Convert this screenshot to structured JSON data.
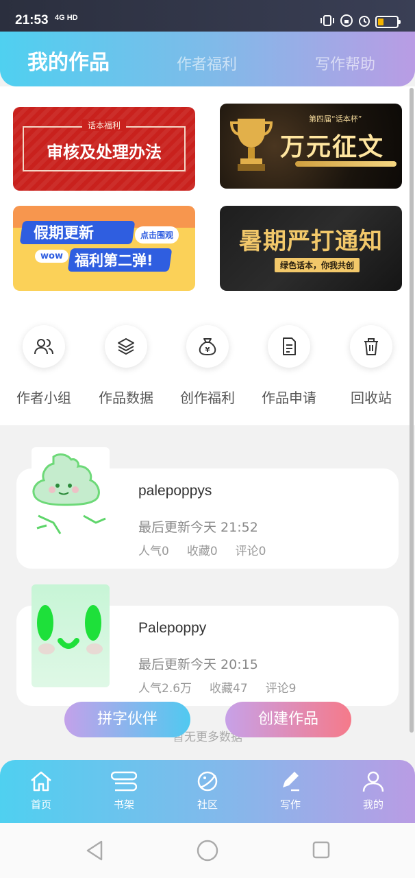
{
  "status_bar": {
    "time": "21:53",
    "network": "4G HD"
  },
  "header": {
    "tabs": [
      {
        "label": "我的作品",
        "active": true
      },
      {
        "label": "作者福利",
        "active": false
      },
      {
        "label": "写作帮助",
        "active": false
      }
    ]
  },
  "banners": [
    {
      "tag": "话本福利",
      "title": "审核及处理办法"
    },
    {
      "small": "第四届“话本杯”",
      "title": "万元征文"
    },
    {
      "title": "假期更新",
      "pill": "点击围观",
      "wow": "wow",
      "subtitle": "福利第二弹!"
    },
    {
      "title": "暑期严打通知",
      "subtitle": "绿色话本，你我共创"
    }
  ],
  "shortcuts": [
    {
      "label": "作者小组",
      "icon": "users-icon"
    },
    {
      "label": "作品数据",
      "icon": "layers-icon"
    },
    {
      "label": "创作福利",
      "icon": "money-bag-icon"
    },
    {
      "label": "作品申请",
      "icon": "document-icon"
    },
    {
      "label": "回收站",
      "icon": "trash-icon"
    }
  ],
  "works": [
    {
      "title": "palepoppys",
      "updated": "最后更新今天 21:52",
      "stats": [
        "人气0",
        "收藏0",
        "评论0"
      ]
    },
    {
      "title": "Palepoppy",
      "updated": "最后更新今天 20:15",
      "stats": [
        "人气2.6万",
        "收藏47",
        "评论9"
      ]
    }
  ],
  "list_end_text": "暂无更多数据",
  "fab": {
    "left_label": "拼字伙伴",
    "right_label": "创建作品"
  },
  "tabbar": [
    {
      "label": "首页",
      "icon": "home-icon"
    },
    {
      "label": "书架",
      "icon": "bookshelf-icon"
    },
    {
      "label": "社区",
      "icon": "planet-icon"
    },
    {
      "label": "写作",
      "icon": "pen-icon"
    },
    {
      "label": "我的",
      "icon": "user-icon"
    }
  ]
}
